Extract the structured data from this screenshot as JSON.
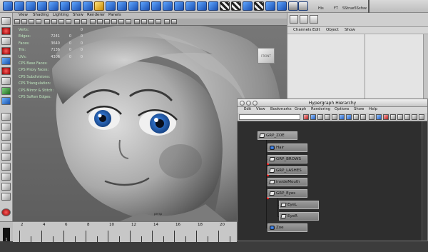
{
  "viewport": {
    "menu": [
      "View",
      "Shading",
      "Lighting",
      "Show",
      "Renderer",
      "Panels"
    ],
    "hud": [
      {
        "label": "Verts:",
        "value": "",
        "a": "",
        "b": "0"
      },
      {
        "label": "Edges:",
        "value": "7241",
        "a": "0",
        "b": "0"
      },
      {
        "label": "Faces:",
        "value": "3640",
        "a": "0",
        "b": "0"
      },
      {
        "label": "Tris:",
        "value": "7136",
        "a": "0",
        "b": "0"
      },
      {
        "label": "UVs:",
        "value": "4306",
        "a": "0",
        "b": "0"
      },
      {
        "label": "CPS Base Faces:",
        "value": "",
        "a": "",
        "b": ""
      },
      {
        "label": "CPS Proxy Faces:",
        "value": "",
        "a": "",
        "b": ""
      },
      {
        "label": "CPS Subdivisions:",
        "value": "",
        "a": "",
        "b": ""
      },
      {
        "label": "CPS Triangulation:",
        "value": "",
        "a": "",
        "b": ""
      },
      {
        "label": "CPS Mirror & Stitch:",
        "value": "",
        "a": "",
        "b": ""
      },
      {
        "label": "CPS Soften Edges:",
        "value": "",
        "a": "",
        "b": ""
      }
    ],
    "viewcube_label": "FRONT",
    "camera_label": "persp"
  },
  "shelf": {
    "right_labels": [
      "His",
      "FT",
      "SStrue5Ssfsw"
    ]
  },
  "channel_box": {
    "menu": [
      "Channels",
      "Edit",
      "Object",
      "Show"
    ]
  },
  "hypergraph": {
    "title": "Hypergraph Hierarchy",
    "menu": [
      "Edit",
      "View",
      "Bookmarks",
      "Graph",
      "Rendering",
      "Options",
      "Show",
      "Help"
    ],
    "nodes": [
      {
        "label": "GRP_ZOE",
        "icon": "transform-icon"
      },
      {
        "label": "Hair",
        "icon": "mesh-icon"
      },
      {
        "label": "GRP_BROWS",
        "icon": "transform-icon"
      },
      {
        "label": "GRP_LASHES",
        "icon": "transform-icon"
      },
      {
        "label": "insideMouth",
        "icon": "transform-icon"
      },
      {
        "label": "GRP_Eyes",
        "icon": "transform-icon"
      },
      {
        "label": "EyeL",
        "icon": "transform-icon"
      },
      {
        "label": "EyeR",
        "icon": "transform-icon"
      },
      {
        "label": "Zoe",
        "icon": "mesh-icon"
      }
    ]
  },
  "timeline": {
    "current_frame": "1",
    "tick_labels": [
      "2",
      "4",
      "6",
      "8",
      "10",
      "12",
      "14",
      "16",
      "18",
      "20"
    ]
  }
}
